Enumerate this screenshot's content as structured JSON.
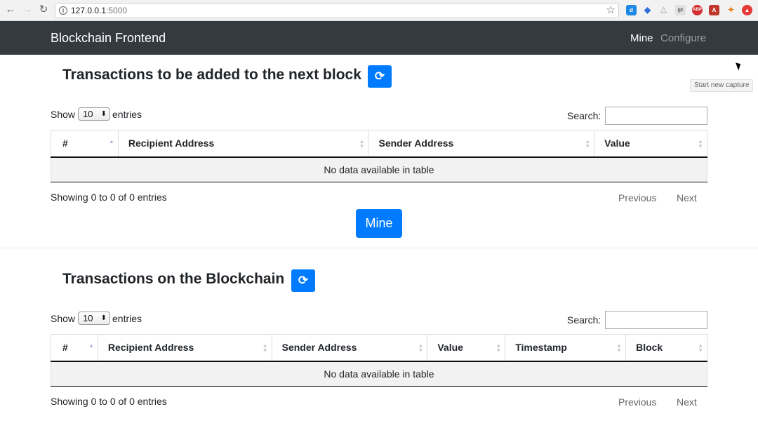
{
  "browser": {
    "url_host": "127.0.0.1",
    "url_port": ":5000"
  },
  "navbar": {
    "brand": "Blockchain Frontend",
    "links": [
      "Mine",
      "Configure"
    ]
  },
  "tooltip": "Start new capture",
  "pending": {
    "title": "Transactions to be added to the next block",
    "show_label": "Show",
    "entries_value": "10",
    "entries_label": "entries",
    "search_label": "Search:",
    "columns": [
      "#",
      "Recipient Address",
      "Sender Address",
      "Value"
    ],
    "empty_message": "No data available in table",
    "info": "Showing 0 to 0 of 0 entries",
    "prev": "Previous",
    "next": "Next"
  },
  "mine_button": "Mine",
  "chain": {
    "title": "Transactions on the Blockchain",
    "show_label": "Show",
    "entries_value": "10",
    "entries_label": "entries",
    "search_label": "Search:",
    "columns": [
      "#",
      "Recipient Address",
      "Sender Address",
      "Value",
      "Timestamp",
      "Block"
    ],
    "empty_message": "No data available in table",
    "info": "Showing 0 to 0 of 0 entries",
    "prev": "Previous",
    "next": "Next"
  }
}
